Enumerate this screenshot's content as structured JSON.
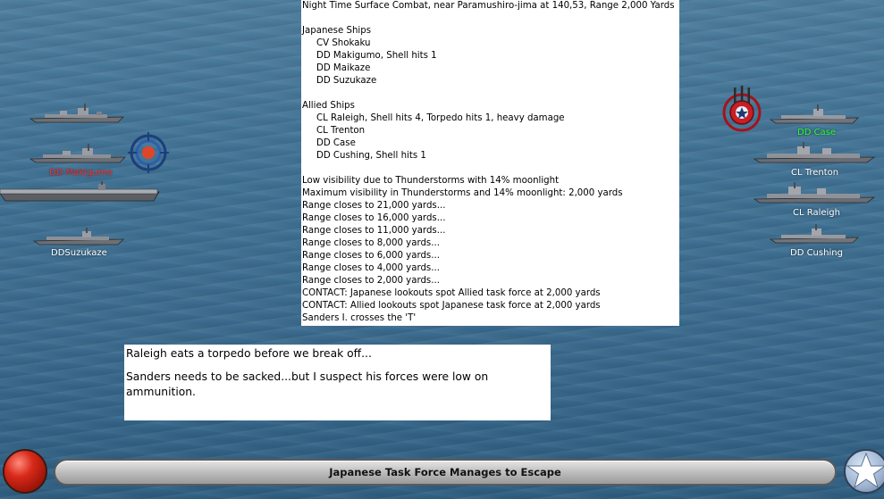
{
  "report": {
    "header": "Night Time Surface Combat, near Paramushiro-jima at 140,53, Range 2,000 Yards",
    "japanese_title": "Japanese Ships",
    "japanese_ships": [
      "CV Shokaku",
      "DD Makigumo, Shell hits 1",
      "DD Maikaze",
      "DD Suzukaze"
    ],
    "allied_title": "Allied Ships",
    "allied_ships": [
      "CL Raleigh, Shell hits 4, Torpedo hits 1,  heavy damage",
      "CL Trenton",
      "DD Case",
      "DD Cushing, Shell hits 1"
    ],
    "events": [
      "Low visibility due to Thunderstorms  with 14% moonlight",
      "Maximum visibility in Thunderstorms and 14% moonlight: 2,000 yards",
      "Range closes to 21,000 yards...",
      "Range closes to 16,000 yards...",
      "Range closes to 11,000 yards...",
      "Range closes to 8,000 yards...",
      "Range closes to 6,000 yards...",
      "Range closes to 4,000 yards...",
      "Range closes to 2,000 yards...",
      "CONTACT: Japanese lookouts spot Allied task force at 2,000 yards",
      "CONTACT: Allied lookouts spot Japanese task force at 2,000 yards",
      "Sanders I. crosses the 'T'"
    ]
  },
  "notes": {
    "line1": "Raleigh eats a torpedo before we break off...",
    "line2": "Sanders needs to be sacked...but I suspect his forces were low on ammunition."
  },
  "japanese_labels": {
    "makigumo": "DD Makigumo",
    "suzukaze": "DDSuzukaze"
  },
  "allied_labels": {
    "case": "DD Case",
    "trenton": "CL Trenton",
    "raleigh": "CL Raleigh",
    "cushing": "DD Cushing"
  },
  "status": {
    "message": "Japanese Task Force Manages to Escape"
  },
  "colors": {
    "sea": "#3f7194",
    "targeted_japanese": "#ff2a2a",
    "active_allied": "#2dff2d"
  },
  "icons": {
    "japanese_target": "target-reticle-icon",
    "allied_target": "anti-aircraft-target-icon",
    "end_turn": "red-button-icon",
    "allied_emblem": "white-star-icon"
  }
}
